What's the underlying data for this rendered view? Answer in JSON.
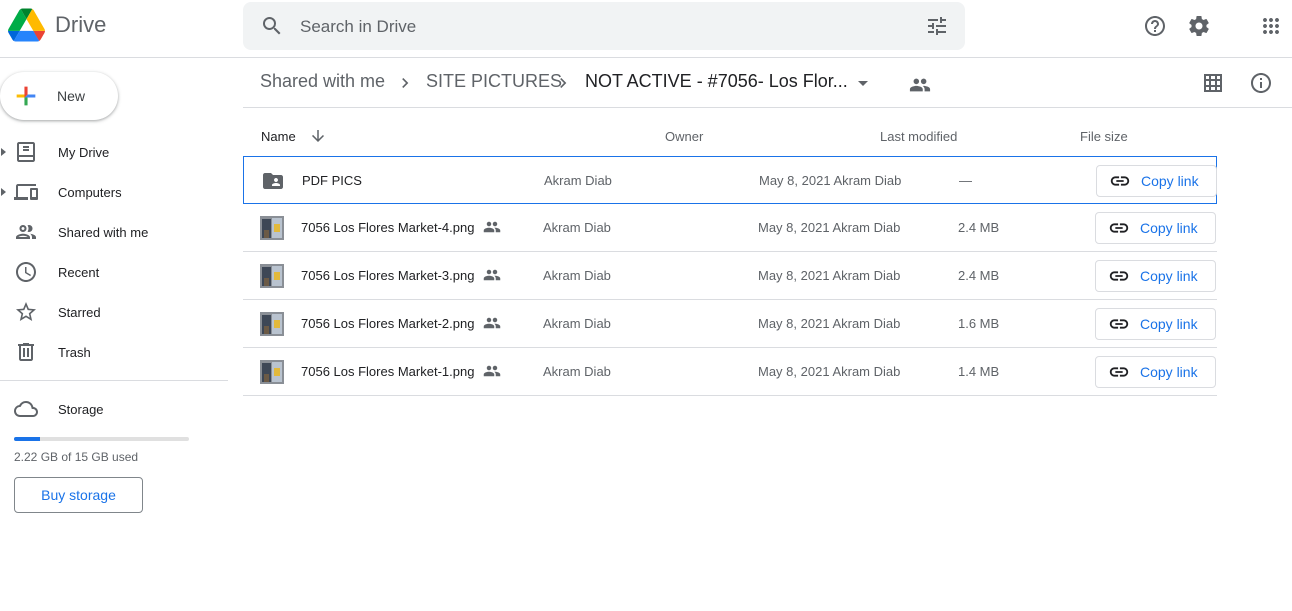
{
  "app": {
    "name": "Drive"
  },
  "search": {
    "placeholder": "Search in Drive"
  },
  "sidebar": {
    "new_label": "New",
    "items": [
      {
        "label": "My Drive",
        "icon": "my-drive-icon",
        "expandable": true
      },
      {
        "label": "Computers",
        "icon": "computers-icon",
        "expandable": true
      },
      {
        "label": "Shared with me",
        "icon": "shared-with-me-icon",
        "expandable": false
      },
      {
        "label": "Recent",
        "icon": "clock-icon",
        "expandable": false
      },
      {
        "label": "Starred",
        "icon": "star-icon",
        "expandable": false
      },
      {
        "label": "Trash",
        "icon": "trash-icon",
        "expandable": false
      }
    ],
    "storage": {
      "label": "Storage",
      "used_text": "2.22 GB of 15 GB used",
      "used_fraction": 0.148,
      "buy_label": "Buy storage"
    }
  },
  "breadcrumb": {
    "items": [
      "Shared with me",
      "SITE PICTURES",
      "NOT ACTIVE - #7056- Los Flor..."
    ]
  },
  "table": {
    "headers": {
      "name": "Name",
      "owner": "Owner",
      "modified": "Last modified",
      "size": "File size"
    },
    "copy_link_label": "Copy link",
    "rows": [
      {
        "name": "PDF PICS",
        "type": "folder",
        "shared": false,
        "owner": "Akram Diab",
        "modified": "May 8, 2021  Akram Diab",
        "size": "—",
        "selected": true
      },
      {
        "name": "7056 Los Flores Market-4.png",
        "type": "image",
        "shared": true,
        "owner": "Akram Diab",
        "modified": "May 8, 2021  Akram Diab",
        "size": "2.4 MB",
        "selected": false
      },
      {
        "name": "7056 Los Flores Market-3.png",
        "type": "image",
        "shared": true,
        "owner": "Akram Diab",
        "modified": "May 8, 2021  Akram Diab",
        "size": "2.4 MB",
        "selected": false
      },
      {
        "name": "7056 Los Flores Market-2.png",
        "type": "image",
        "shared": true,
        "owner": "Akram Diab",
        "modified": "May 8, 2021  Akram Diab",
        "size": "1.6 MB",
        "selected": false
      },
      {
        "name": "7056 Los Flores Market-1.png",
        "type": "image",
        "shared": true,
        "owner": "Akram Diab",
        "modified": "May 8, 2021  Akram Diab",
        "size": "1.4 MB",
        "selected": false
      }
    ]
  },
  "colors": {
    "accent": "#1a73e8",
    "text": "#202124",
    "muted": "#5f6368",
    "border": "#dadce0"
  }
}
